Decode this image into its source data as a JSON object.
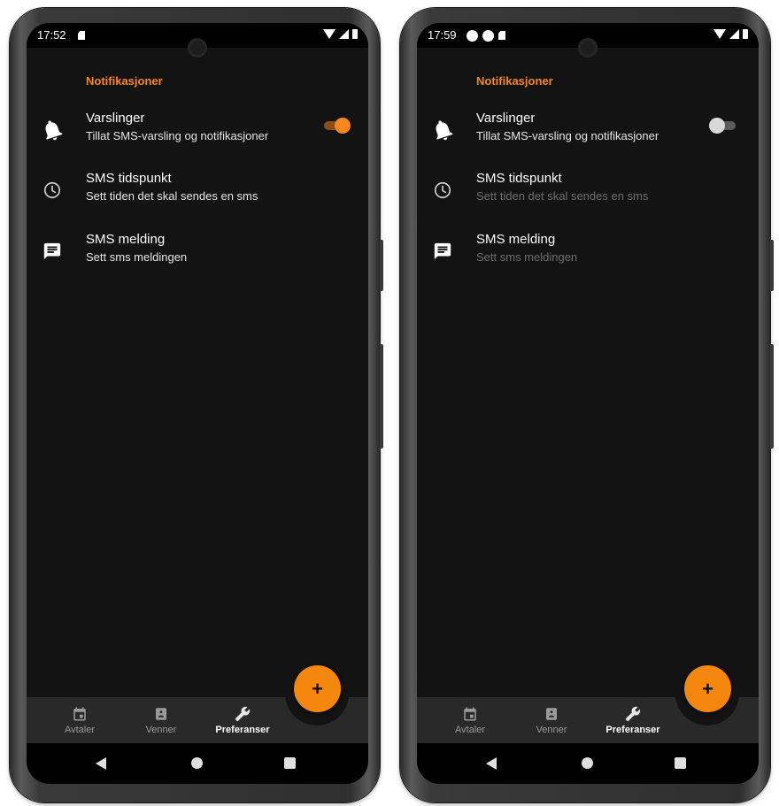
{
  "colors": {
    "accent": "#f5871f",
    "screen_bg": "#131313",
    "nav_bg": "#292929"
  },
  "left": {
    "status": {
      "time": "17:52",
      "icons_left": [
        "sdcard-icon"
      ]
    },
    "section_header": "Notifikasjoner",
    "items": [
      {
        "icon": "bell-icon",
        "title": "Varslinger",
        "summary": "Tillat SMS-varsling og notifikasjoner",
        "toggle": "on"
      },
      {
        "icon": "clock-icon",
        "title": "SMS tidspunkt",
        "summary": "Sett tiden det skal sendes en sms"
      },
      {
        "icon": "message-icon",
        "title": "SMS melding",
        "summary": "Sett sms meldingen"
      }
    ],
    "fab_label": "+",
    "nav": [
      {
        "icon": "calendar-icon",
        "label": "Avtaler",
        "active": false
      },
      {
        "icon": "contacts-icon",
        "label": "Venner",
        "active": false
      },
      {
        "icon": "wrench-icon",
        "label": "Preferanser",
        "active": true
      }
    ]
  },
  "right": {
    "status": {
      "time": "17:59",
      "icons_left": [
        "circle-icon",
        "circle-icon",
        "sdcard-icon"
      ]
    },
    "section_header": "Notifikasjoner",
    "items": [
      {
        "icon": "bell-icon",
        "title": "Varslinger",
        "summary": "Tillat SMS-varsling og notifikasjoner",
        "toggle": "off"
      },
      {
        "icon": "clock-icon",
        "title": "SMS tidspunkt",
        "summary": "Sett tiden det skal sendes en sms",
        "disabled": true
      },
      {
        "icon": "message-icon",
        "title": "SMS melding",
        "summary": "Sett sms meldingen",
        "disabled": true
      }
    ],
    "fab_label": "+",
    "nav": [
      {
        "icon": "calendar-icon",
        "label": "Avtaler",
        "active": false
      },
      {
        "icon": "contacts-icon",
        "label": "Venner",
        "active": false
      },
      {
        "icon": "wrench-icon",
        "label": "Preferanser",
        "active": true
      }
    ]
  }
}
